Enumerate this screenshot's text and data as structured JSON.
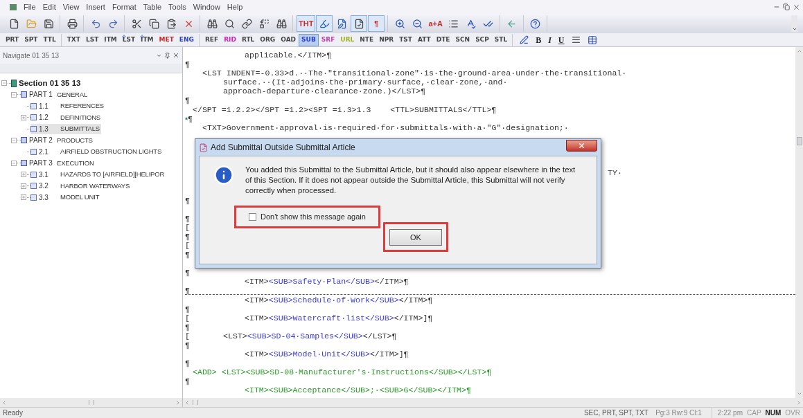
{
  "menu": [
    "File",
    "Edit",
    "View",
    "Insert",
    "Format",
    "Table",
    "Tools",
    "Window",
    "Help"
  ],
  "toolbar": {
    "groups": [
      {
        "buttons": [
          {
            "kind": "new",
            "pressed": false
          },
          {
            "kind": "open",
            "pressed": false
          },
          {
            "kind": "save",
            "pressed": false
          }
        ]
      },
      {
        "buttons": [
          {
            "kind": "print",
            "pressed": false
          }
        ]
      },
      {
        "buttons": [
          {
            "kind": "undo",
            "pressed": false
          },
          {
            "kind": "redo",
            "pressed": false
          }
        ]
      },
      {
        "buttons": [
          {
            "kind": "cut",
            "pressed": false
          },
          {
            "kind": "copy",
            "pressed": false
          },
          {
            "kind": "paste",
            "pressed": false
          },
          {
            "kind": "delete",
            "pressed": false
          }
        ]
      },
      {
        "buttons": [
          {
            "kind": "find",
            "pressed": false
          },
          {
            "kind": "find-next",
            "pressed": false
          },
          {
            "kind": "find-link",
            "pressed": false
          },
          {
            "kind": "replace",
            "pressed": false
          },
          {
            "kind": "find-more",
            "pressed": false
          }
        ]
      },
      {
        "buttons": [
          {
            "kind": "text",
            "label": "THT",
            "pressed": true
          },
          {
            "kind": "highlight",
            "pressed": true
          },
          {
            "kind": "edit",
            "pressed": false
          },
          {
            "kind": "check",
            "pressed": true
          },
          {
            "kind": "text",
            "label": "¶",
            "pressed": true
          }
        ]
      },
      {
        "buttons": [
          {
            "kind": "zoom-in",
            "pressed": false
          },
          {
            "kind": "zoom-out",
            "pressed": false
          },
          {
            "kind": "text",
            "label": "a+A",
            "pressed": false
          },
          {
            "kind": "list",
            "pressed": false
          },
          {
            "kind": "spell",
            "pressed": false
          },
          {
            "kind": "spell-next",
            "pressed": false
          }
        ]
      },
      {
        "buttons": [
          {
            "kind": "back",
            "pressed": false
          }
        ]
      },
      {
        "buttons": [
          {
            "kind": "help",
            "pressed": false
          }
        ]
      }
    ]
  },
  "tag_bar": {
    "groups": [
      {
        "tags": [
          {
            "label": "PRT",
            "selected": false
          },
          {
            "label": "SPT",
            "selected": false
          },
          {
            "label": "TTL",
            "selected": false
          }
        ]
      },
      {
        "tags": [
          {
            "label": "TXT",
            "selected": false
          },
          {
            "label": "LST",
            "selected": false
          },
          {
            "label": "ITM",
            "selected": false
          },
          {
            "label": "LST",
            "selected": false,
            "marked": true
          },
          {
            "label": "ITM",
            "selected": false,
            "marked": true
          },
          {
            "label": "MET",
            "color": "#d02828",
            "selected": false
          },
          {
            "label": "ENG",
            "color": "#2840c8",
            "selected": false
          }
        ]
      },
      {
        "tags": [
          {
            "label": "REF",
            "selected": false
          },
          {
            "label": "RID",
            "color": "#d020c0",
            "selected": false
          },
          {
            "label": "RTL",
            "selected": false
          },
          {
            "label": "ORG",
            "selected": false
          },
          {
            "label": "OAD",
            "selected": false
          },
          {
            "label": "SUB",
            "color": "#2840c8",
            "selected": true
          },
          {
            "label": "SRF",
            "color": "#c040b0",
            "selected": false
          },
          {
            "label": "URL",
            "color": "#a0b020",
            "selected": false
          },
          {
            "label": "NTE",
            "selected": false
          },
          {
            "label": "NPR",
            "selected": false
          },
          {
            "label": "TST",
            "selected": false
          },
          {
            "label": "ATT",
            "selected": false
          },
          {
            "label": "DTE",
            "selected": false
          },
          {
            "label": "SCN",
            "selected": false
          },
          {
            "label": "SCP",
            "selected": false
          },
          {
            "label": "STL",
            "selected": false
          }
        ]
      }
    ],
    "format_buttons": [
      {
        "kind": "pen"
      },
      {
        "kind": "bold",
        "label": "B"
      },
      {
        "kind": "italic",
        "label": "I"
      },
      {
        "kind": "underline",
        "label": "U"
      },
      {
        "kind": "align"
      },
      {
        "kind": "table"
      }
    ]
  },
  "navigator": {
    "title": "Navigate 01 35 13",
    "tree": [
      {
        "kind": "section",
        "title": "Section 01 35 13",
        "expanded": true,
        "selected": false,
        "children": [
          {
            "kind": "part",
            "number": "PART 1",
            "title": "GENERAL",
            "expanded": true,
            "selected": false,
            "children": [
              {
                "kind": "article",
                "number": "1.1",
                "title": "REFERENCES",
                "selected": false
              },
              {
                "kind": "article",
                "number": "1.2",
                "title": "DEFINITIONS",
                "expanded": false,
                "selected": false
              },
              {
                "kind": "article",
                "number": "1.3",
                "title": "SUBMITTALS",
                "selected": true
              }
            ]
          },
          {
            "kind": "part",
            "number": "PART 2",
            "title": "PRODUCTS",
            "expanded": true,
            "selected": false,
            "children": [
              {
                "kind": "article",
                "number": "2.1",
                "title": "AIRFIELD OBSTRUCTION LIGHTS",
                "selected": false
              }
            ]
          },
          {
            "kind": "part",
            "number": "PART 3",
            "title": "EXECUTION",
            "expanded": true,
            "selected": false,
            "children": [
              {
                "kind": "article",
                "number": "3.1",
                "title": "HAZARDS TO [AIRFIELD][HELIPOR",
                "expanded": false,
                "selected": false
              },
              {
                "kind": "article",
                "number": "3.2",
                "title": "HARBOR WATERWAYS",
                "expanded": false,
                "selected": false
              },
              {
                "kind": "article",
                "number": "3.3",
                "title": "MODEL UNIT",
                "expanded": false,
                "selected": false
              }
            ]
          }
        ]
      }
    ]
  },
  "editor": {
    "lines": [
      {
        "kind": "item",
        "segments": [
          {
            "kind": "tag",
            "text": "applicable.</ITM>¶"
          }
        ]
      },
      {
        "kind": "mark",
        "margin": "¶"
      },
      {
        "kind": "list",
        "segments": [
          {
            "kind": "tag",
            "text": "<LST INDENT=-0.33>d.··The·\"transitional·zone\"·is·the·ground·area·under·the·transitional·"
          }
        ]
      },
      {
        "kind": "wrap",
        "segments": [
          {
            "kind": "tag",
            "text": "surface.··(It·adjoins·the·primary·surface,·clear·zone,·and·"
          }
        ]
      },
      {
        "kind": "wrap",
        "segments": [
          {
            "kind": "tag",
            "text": "approach-departure·clearance·zone.)</LST>¶"
          }
        ]
      },
      {
        "kind": "mark",
        "margin": "¶"
      },
      {
        "kind": "flush",
        "segments": [
          {
            "kind": "tag",
            "text": "</SPT =1.2.2></SPT =1.2><SPT =1.3>1.3    <TTL>SUBMITTALS</TTL>¶"
          }
        ]
      },
      {
        "kind": "mark",
        "margin": "¶",
        "bookmark": true
      },
      {
        "kind": "list",
        "segments": [
          {
            "kind": "tag",
            "text": "<TXT>Government·approval·is·required·for·submittals·with·a·\"G\"·designation;·"
          }
        ]
      },
      {
        "kind": "blank"
      },
      {
        "kind": "blank"
      },
      {
        "kind": "blank"
      },
      {
        "kind": "blank"
      },
      {
        "kind": "tail",
        "segments": [
          {
            "kind": "tag",
            "text": "TY·"
          }
        ]
      },
      {
        "kind": "blank"
      },
      {
        "kind": "blank"
      },
      {
        "kind": "mark",
        "margin": "¶"
      },
      {
        "kind": "blank"
      },
      {
        "kind": "mark",
        "margin": "¶"
      },
      {
        "kind": "mark",
        "margin": "["
      },
      {
        "kind": "mark",
        "margin": "¶"
      },
      {
        "kind": "mark",
        "margin": "["
      },
      {
        "kind": "mark",
        "margin": "¶"
      },
      {
        "kind": "blank"
      },
      {
        "kind": "mark",
        "margin": "¶"
      },
      {
        "kind": "item",
        "segments": [
          {
            "kind": "tag",
            "text": "<ITM>"
          },
          {
            "kind": "sub",
            "text": "<SUB>Safety·Plan</SUB>"
          },
          {
            "kind": "tag",
            "text": "</ITM>¶"
          }
        ]
      },
      {
        "kind": "mark",
        "margin": "¶"
      },
      {
        "kind": "item",
        "page_break": true,
        "segments": [
          {
            "kind": "tag",
            "text": "<ITM>"
          },
          {
            "kind": "sub",
            "text": "<SUB>Schedule·of·Work</SUB>"
          },
          {
            "kind": "tag",
            "text": "</ITM>¶"
          }
        ]
      },
      {
        "kind": "mark",
        "margin": "¶"
      },
      {
        "kind": "item",
        "margin": "[",
        "segments": [
          {
            "kind": "tag",
            "text": "<ITM>"
          },
          {
            "kind": "sub",
            "text": "<SUB>Watercraft·list</SUB>"
          },
          {
            "kind": "tag",
            "text": "</ITM>]¶"
          }
        ]
      },
      {
        "kind": "mark",
        "margin": "¶"
      },
      {
        "kind": "wrap",
        "margin": "[",
        "segments": [
          {
            "kind": "tag",
            "text": "<LST>"
          },
          {
            "kind": "sub",
            "text": "<SUB>SD-04·Samples</SUB>"
          },
          {
            "kind": "tag",
            "text": "</LST>¶"
          }
        ]
      },
      {
        "kind": "mark",
        "margin": "¶"
      },
      {
        "kind": "item",
        "segments": [
          {
            "kind": "tag",
            "text": "<ITM>"
          },
          {
            "kind": "sub",
            "text": "<SUB>Model·Unit</SUB>"
          },
          {
            "kind": "tag",
            "text": "</ITM>]¶"
          }
        ]
      },
      {
        "kind": "mark",
        "margin": "¶"
      },
      {
        "kind": "flush",
        "segments": [
          {
            "kind": "added",
            "text": "<ADD> <LST><SUB>SD-08·Manufacturer's·Instructions</SUB></LST>¶"
          }
        ]
      },
      {
        "kind": "mark",
        "margin": "¶"
      },
      {
        "kind": "item",
        "segments": [
          {
            "kind": "added",
            "text": "<ITM><SUB>Acceptance</SUB>;·<SUB>G</SUB></ITM>¶"
          }
        ]
      }
    ]
  },
  "dialog": {
    "title": "Add Submittal Outside Submittal Article",
    "message": "You added this Submittal to the Submittal Article, but it should also appear elsewhere in the text of this Section.  If it does not appear outside the Submittal Article, this Submittal will not verify correctly when processed.",
    "checkbox": {
      "label": "Don't show this message again",
      "checked": false,
      "highlighted": true
    },
    "ok_button": {
      "label": "OK",
      "highlighted": true
    }
  },
  "status_bar": {
    "message": "Ready",
    "tags": "SEC, PRT, SPT, TXT",
    "position": "Pg:3 Rw:9 Cl:1",
    "time": "2:22 pm",
    "indicators": [
      {
        "label": "CAP",
        "on": false
      },
      {
        "label": "NUM",
        "on": true
      },
      {
        "label": "OVR",
        "on": false
      }
    ]
  }
}
